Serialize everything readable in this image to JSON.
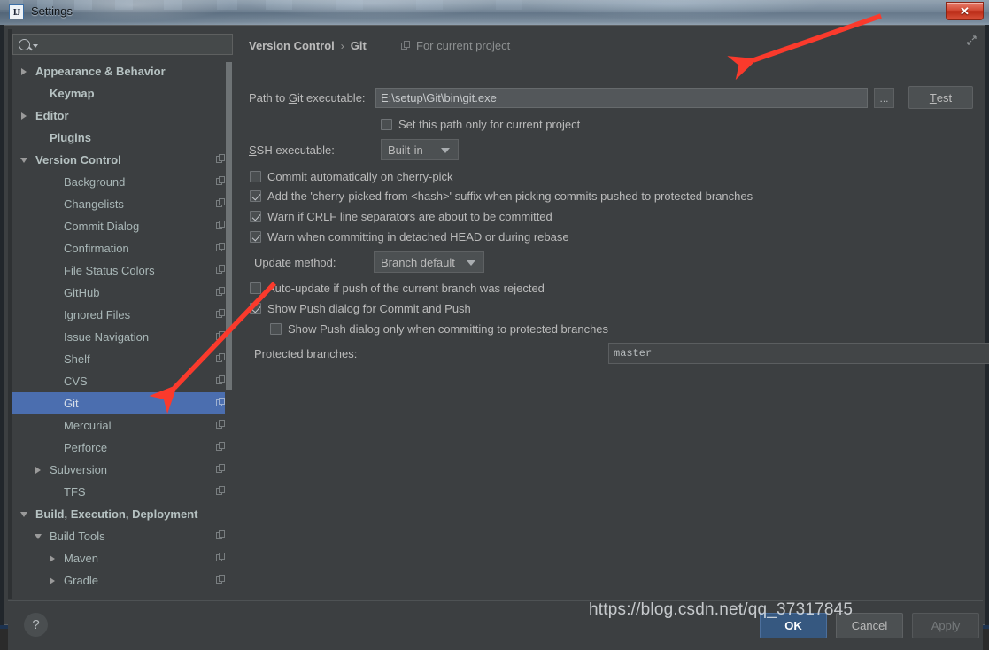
{
  "window": {
    "title": "Settings",
    "app_icon": "intellij-idea-icon",
    "close_label": "✕"
  },
  "sidebar": {
    "search": {
      "value": "",
      "placeholder": "",
      "icon": "search-icon"
    },
    "items": [
      {
        "label": "Appearance & Behavior",
        "indent": 1,
        "twisty": "right",
        "bold": true,
        "copy": false,
        "selected": false
      },
      {
        "label": "Keymap",
        "indent": 2,
        "twisty": "none",
        "bold": true,
        "copy": false,
        "selected": false
      },
      {
        "label": "Editor",
        "indent": 1,
        "twisty": "right",
        "bold": true,
        "copy": false,
        "selected": false
      },
      {
        "label": "Plugins",
        "indent": 2,
        "twisty": "none",
        "bold": true,
        "copy": false,
        "selected": false
      },
      {
        "label": "Version Control",
        "indent": 1,
        "twisty": "down",
        "bold": true,
        "copy": true,
        "selected": false
      },
      {
        "label": "Background",
        "indent": 3,
        "twisty": "none",
        "bold": false,
        "copy": true,
        "selected": false
      },
      {
        "label": "Changelists",
        "indent": 3,
        "twisty": "none",
        "bold": false,
        "copy": true,
        "selected": false
      },
      {
        "label": "Commit Dialog",
        "indent": 3,
        "twisty": "none",
        "bold": false,
        "copy": true,
        "selected": false
      },
      {
        "label": "Confirmation",
        "indent": 3,
        "twisty": "none",
        "bold": false,
        "copy": true,
        "selected": false
      },
      {
        "label": "File Status Colors",
        "indent": 3,
        "twisty": "none",
        "bold": false,
        "copy": true,
        "selected": false
      },
      {
        "label": "GitHub",
        "indent": 3,
        "twisty": "none",
        "bold": false,
        "copy": true,
        "selected": false
      },
      {
        "label": "Ignored Files",
        "indent": 3,
        "twisty": "none",
        "bold": false,
        "copy": true,
        "selected": false
      },
      {
        "label": "Issue Navigation",
        "indent": 3,
        "twisty": "none",
        "bold": false,
        "copy": true,
        "selected": false
      },
      {
        "label": "Shelf",
        "indent": 3,
        "twisty": "none",
        "bold": false,
        "copy": true,
        "selected": false
      },
      {
        "label": "CVS",
        "indent": 3,
        "twisty": "none",
        "bold": false,
        "copy": true,
        "selected": false
      },
      {
        "label": "Git",
        "indent": 3,
        "twisty": "none",
        "bold": false,
        "copy": true,
        "selected": true
      },
      {
        "label": "Mercurial",
        "indent": 3,
        "twisty": "none",
        "bold": false,
        "copy": true,
        "selected": false
      },
      {
        "label": "Perforce",
        "indent": 3,
        "twisty": "none",
        "bold": false,
        "copy": true,
        "selected": false
      },
      {
        "label": "Subversion",
        "indent": 2,
        "twisty": "right",
        "bold": false,
        "copy": true,
        "selected": false
      },
      {
        "label": "TFS",
        "indent": 3,
        "twisty": "none",
        "bold": false,
        "copy": true,
        "selected": false
      },
      {
        "label": "Build, Execution, Deployment",
        "indent": 1,
        "twisty": "down",
        "bold": true,
        "copy": false,
        "selected": false
      },
      {
        "label": "Build Tools",
        "indent": 2,
        "twisty": "down",
        "bold": false,
        "copy": true,
        "selected": false
      },
      {
        "label": "Maven",
        "indent": 3,
        "twisty": "right",
        "bold": false,
        "copy": true,
        "selected": false
      },
      {
        "label": "Gradle",
        "indent": 3,
        "twisty": "right",
        "bold": false,
        "copy": true,
        "selected": false
      }
    ]
  },
  "main": {
    "breadcrumb": {
      "root": "Version Control",
      "separator": "›",
      "current": "Git"
    },
    "for_current_project": "For current project",
    "path_label_pre": "Path to ",
    "path_label_mnemonic": "G",
    "path_label_post": "it executable:",
    "path_value": "E:\\setup\\Git\\bin\\git.exe",
    "browse_label": "...",
    "test_label_mnemonic": "T",
    "test_label_post": "est",
    "set_path_only_label": "Set this path only for current project",
    "set_path_only_checked": false,
    "ssh_label_mnemonic": "S",
    "ssh_label_post": "SH executable:",
    "ssh_value": "Built-in",
    "checkboxes": [
      {
        "label": "Commit automatically on cherry-pick",
        "checked": false
      },
      {
        "label": "Add the 'cherry-picked from <hash>' suffix when picking commits pushed to protected branches",
        "checked": true
      },
      {
        "label": "Warn if CRLF line separators are about to be committed",
        "checked": true
      },
      {
        "label": "Warn when committing in detached HEAD or during rebase",
        "checked": true
      }
    ],
    "update_method_label": "Update method:",
    "update_method_value": "Branch default",
    "checkboxes2": [
      {
        "label": "Auto-update if push of the current branch was rejected",
        "checked": false
      },
      {
        "label": "Show Push dialog for Commit and Push",
        "checked": true
      },
      {
        "label": "Show Push dialog only when committing to protected branches",
        "checked": false
      }
    ],
    "protected_label": "Protected branches:",
    "protected_value": "master"
  },
  "footer": {
    "help_label": "?",
    "ok_label": "OK",
    "cancel_label": "Cancel",
    "apply_label": "Apply"
  },
  "watermark": "https://blog.csdn.net/qq_37317845",
  "colors": {
    "accent_selection": "#4b6eaf",
    "ok_button": "#365880",
    "panel_bg": "#3c3f41",
    "annotation_arrow": "#fa3a2c"
  }
}
